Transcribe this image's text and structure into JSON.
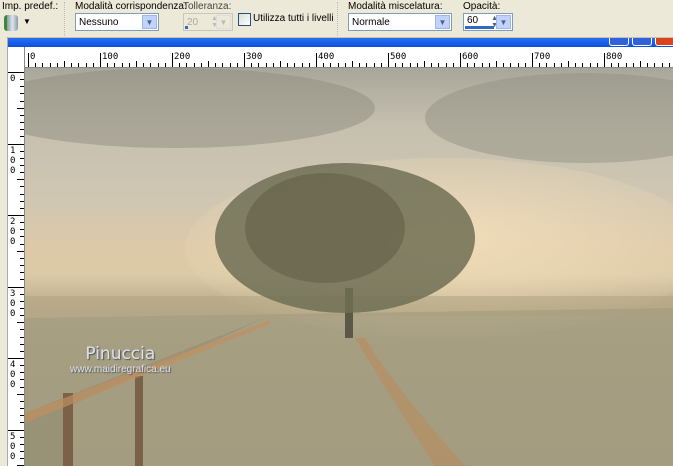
{
  "toolbar": {
    "preset_label": "Imp. predef.:",
    "match_mode_label": "Modalità corrispondenza:",
    "match_mode_value": "Nessuno",
    "tolerance_label": "Tolleranza:",
    "tolerance_value": "20",
    "use_all_layers_label": "Utilizza tutti i livelli",
    "use_all_layers_checked": false,
    "blend_mode_label": "Modalità miscelatura:",
    "blend_mode_value": "Normale",
    "opacity_label": "Opacità:",
    "opacity_value": "60",
    "opacity_percent": 60
  },
  "ruler": {
    "h_labels": [
      "0",
      "100",
      "200",
      "300",
      "400",
      "500",
      "600",
      "700",
      "800"
    ],
    "v_labels": [
      "0",
      "100",
      "200",
      "300",
      "400",
      "500"
    ]
  },
  "watermark": {
    "name": "Pinuccia",
    "url": "www.maidiregrafica.eu"
  }
}
